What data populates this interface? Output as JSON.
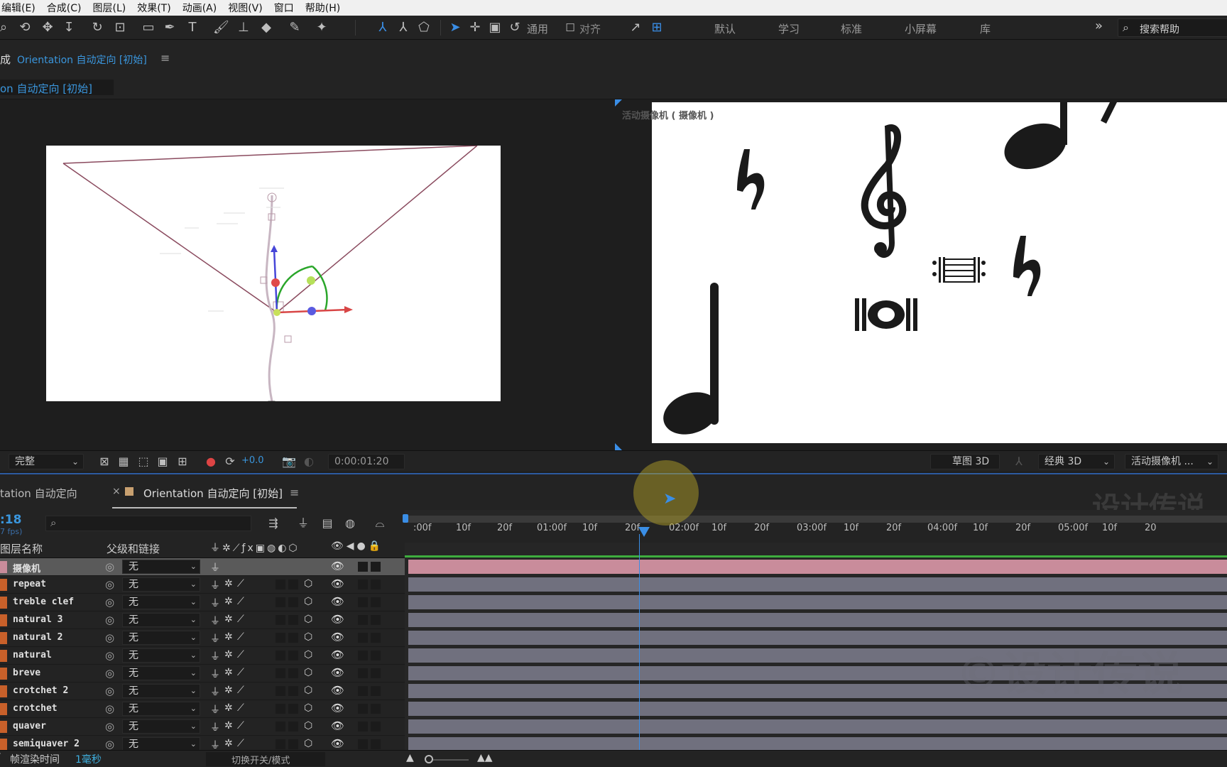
{
  "menu": [
    "编辑(E)",
    "合成(C)",
    "图层(L)",
    "效果(T)",
    "动画(A)",
    "视图(V)",
    "窗口",
    "帮助(H)"
  ],
  "toolbar": {
    "snap_label": "通用",
    "align_label": "对齐",
    "workspaces": [
      "默认",
      "学习",
      "标准",
      "小屏幕",
      "库"
    ],
    "more": "»",
    "search_placeholder": "搜索帮助"
  },
  "comp_header": {
    "prefix": "成",
    "title": "Orientation 自动定向 [初始]",
    "menu": "≡"
  },
  "comp_tab": {
    "label": "on 自动定向 [初始]"
  },
  "right_viewer": {
    "label": "活动摄像机 ( 摄像机 )"
  },
  "viewer_footer": {
    "resolution": "完整",
    "exposure": "+0.0",
    "timecode": "0:00:01:20",
    "draft3d": "草图 3D",
    "renderer": "经典 3D",
    "view": "活动摄像机 ..."
  },
  "timeline": {
    "tab1": "tation 自动定向",
    "tab2": "Orientation 自动定向 [初始]",
    "tab_close": "×",
    "tab_menu": "≡",
    "current_time": ":18",
    "fps": "7 fps)",
    "watermark": "设计传说",
    "watermark2": "©设计传说",
    "col_layer_name": "图层名称",
    "col_parent": "父级和链接",
    "ruler": [
      ":00f",
      "10f",
      "20f",
      "01:00f",
      "10f",
      "20f",
      "02:00f",
      "10f",
      "20f",
      "03:00f",
      "10f",
      "20f",
      "04:00f",
      "10f",
      "20f",
      "05:00f",
      "10f",
      "20"
    ],
    "layers": [
      {
        "name": "摄像机",
        "parent": "无",
        "camera": true
      },
      {
        "name": "repeat",
        "parent": "无"
      },
      {
        "name": "treble clef",
        "parent": "无"
      },
      {
        "name": "natural 3",
        "parent": "无"
      },
      {
        "name": "natural 2",
        "parent": "无"
      },
      {
        "name": "natural",
        "parent": "无"
      },
      {
        "name": "breve",
        "parent": "无"
      },
      {
        "name": "crotchet 2",
        "parent": "无"
      },
      {
        "name": "crotchet",
        "parent": "无"
      },
      {
        "name": "quaver",
        "parent": "无"
      },
      {
        "name": "semiquaver 2",
        "parent": "无"
      }
    ]
  },
  "status": {
    "render_label": "帧渲染时间",
    "render_value": "1毫秒",
    "toggle_label": "切换开关/模式"
  },
  "colors": {
    "accent": "#2c8ae8",
    "camera_bar": "#c98c9b",
    "layer_bar": "#70707e",
    "label_orange": "#c8602a"
  }
}
